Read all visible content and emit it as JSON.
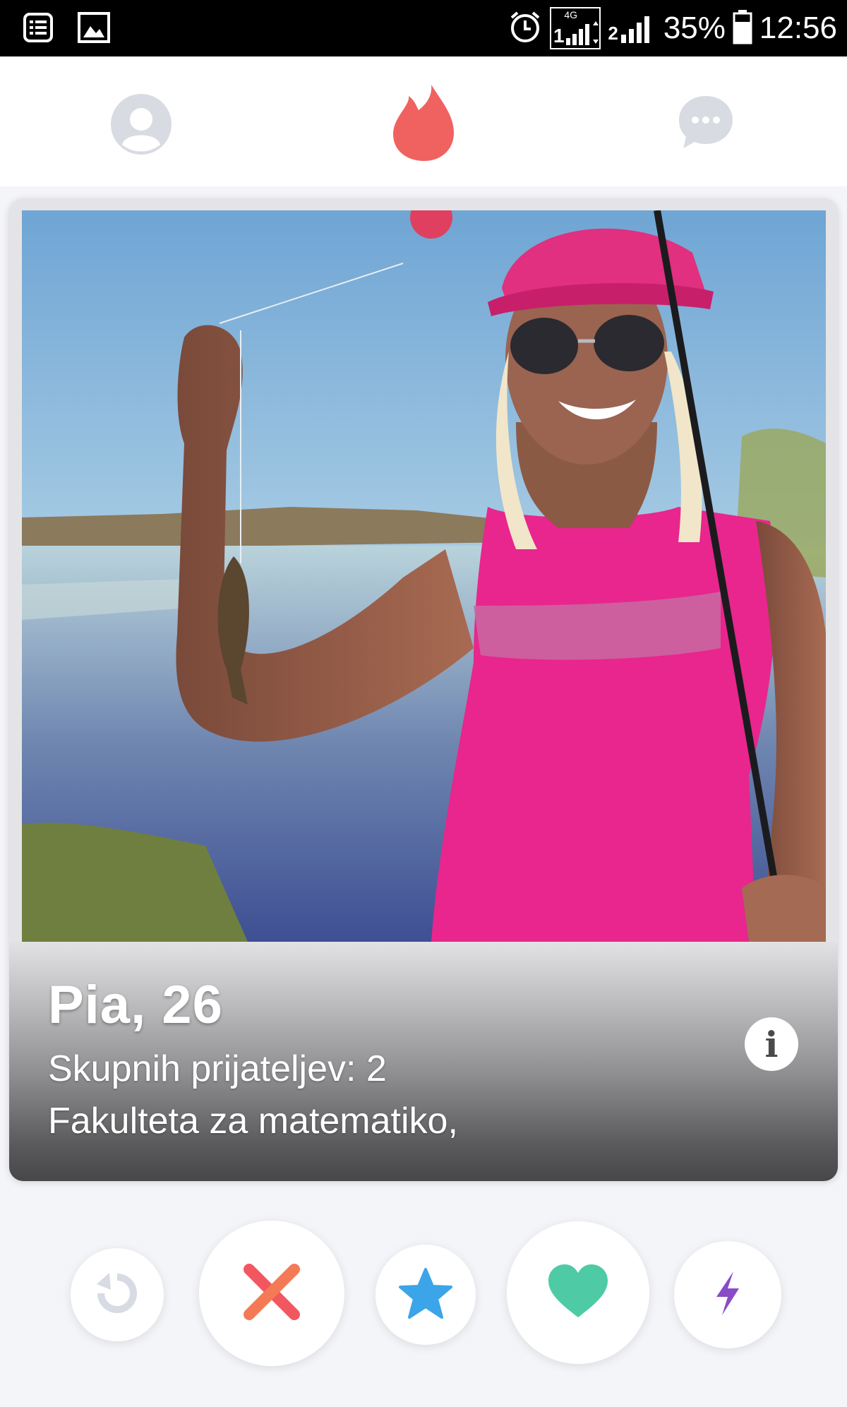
{
  "status_bar": {
    "network": "4G",
    "sim2_label": "2",
    "battery_percent": "35%",
    "time": "12:56",
    "left_icons": [
      "notification-list-icon",
      "gallery-icon"
    ],
    "right_icons": [
      "alarm-icon",
      "signal-4g-icon",
      "signal-icon",
      "battery-icon"
    ]
  },
  "top_nav": {
    "items": [
      "profile-icon",
      "tinder-flame-icon",
      "messages-icon"
    ],
    "active": "tinder-flame-icon",
    "active_color": "#f0625f",
    "inactive_color": "#d8dbe2"
  },
  "profile_card": {
    "name_age": "Pia, 26",
    "mutual_friends": "Skupnih prijateljev: 2",
    "school": "Fakulteta za matematiko,"
  },
  "actions": [
    {
      "name": "rewind-button",
      "icon": "rewind-icon",
      "color": "#d7dbe3"
    },
    {
      "name": "nope-button",
      "icon": "close-x-icon",
      "color": "#f2575f"
    },
    {
      "name": "super-like-button",
      "icon": "star-icon",
      "color": "#3ca4e8"
    },
    {
      "name": "like-button",
      "icon": "heart-icon",
      "color": "#4ecba4"
    },
    {
      "name": "boost-button",
      "icon": "lightning-icon",
      "color": "#8a4bc7"
    }
  ]
}
